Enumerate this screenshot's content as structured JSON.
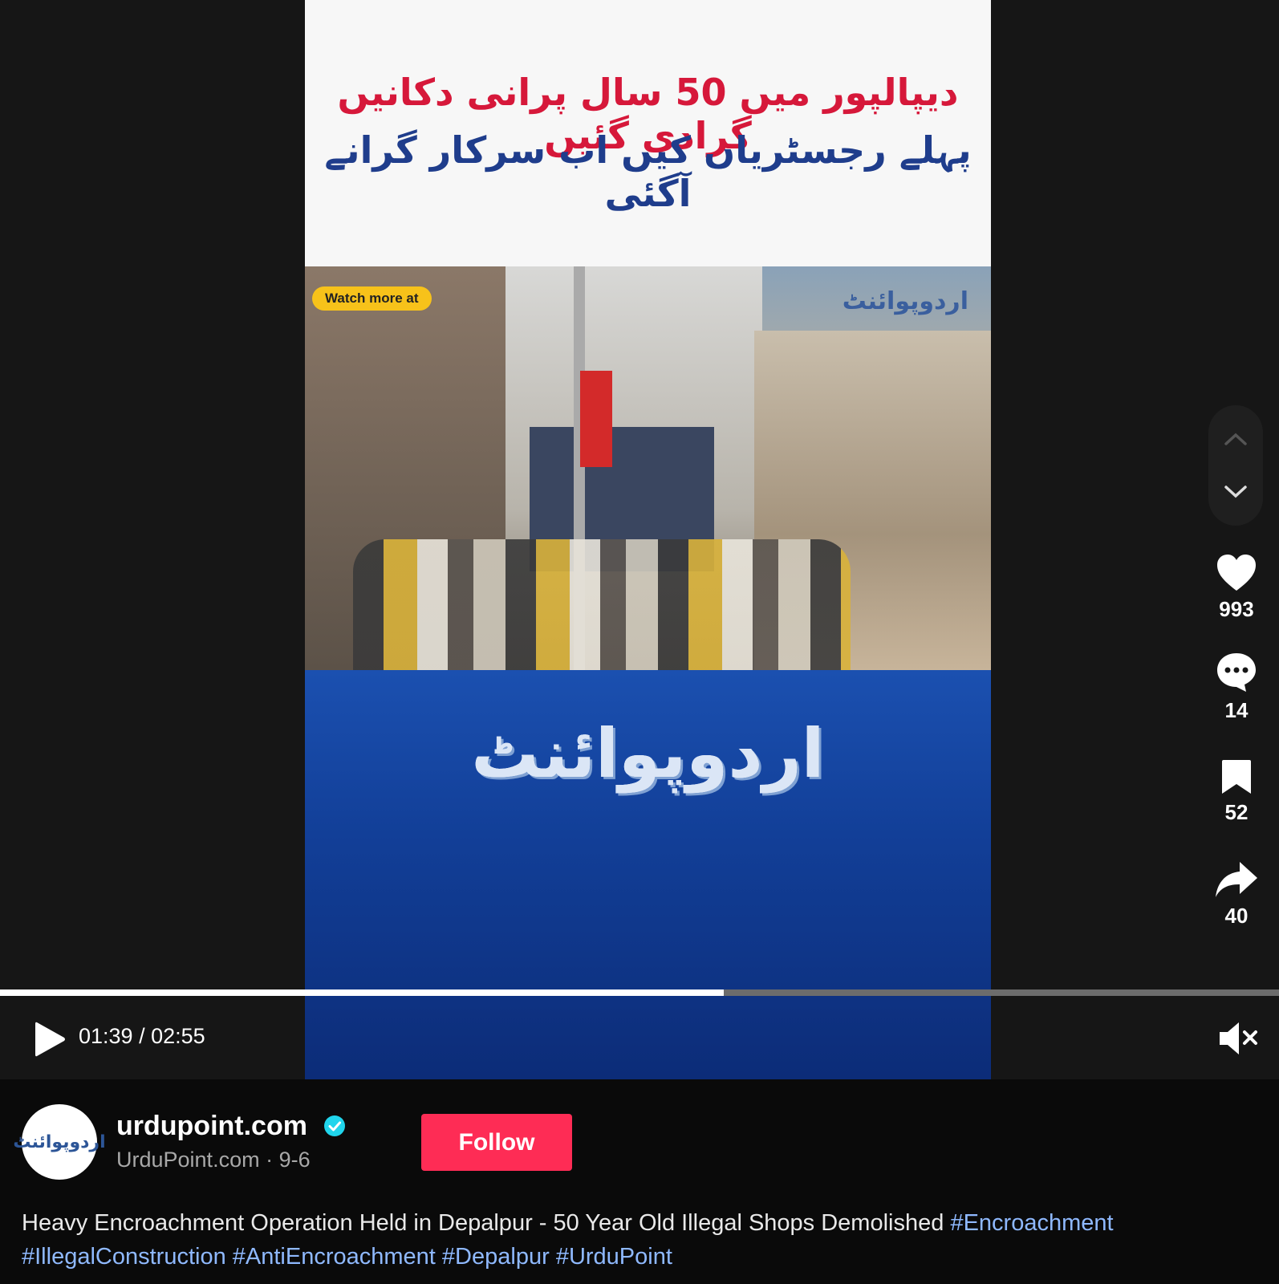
{
  "video": {
    "headline_line1": "دیپالپور میں 50 سال پرانی دکانیں گرادی گئیں",
    "headline_line2": "پہلے رجسٹریاں کیں اب سرکار گرانے آگئی",
    "watch_more": "Watch more at",
    "photo_logo": "اردوپوائنٹ",
    "brand_logo": "اردوپوائنٹ"
  },
  "actions": {
    "likes": "993",
    "comments": "14",
    "saves": "52",
    "shares": "40"
  },
  "player": {
    "current_time": "01:39",
    "duration": "02:55",
    "time_display": "01:39 / 02:55",
    "progress_fraction": 0.566
  },
  "author": {
    "avatar_text": "اردوپوائنٹ",
    "name": "urdupoint.com",
    "subline": "UrduPoint.com · 9-6",
    "follow_label": "Follow"
  },
  "caption": {
    "text": "Heavy Encroachment Operation Held in Depalpur - 50 Year Old Illegal Shops Demolished",
    "hashtags": [
      "#Encroachment",
      "#IllegalConstruction",
      "#AntiEncroachment",
      "#Depalpur",
      "#UrduPoint"
    ]
  },
  "colors": {
    "follow": "#fe2c55",
    "hashtag": "#8fb9ff",
    "headline_red": "#d6183a",
    "headline_blue": "#1f3d8c"
  }
}
